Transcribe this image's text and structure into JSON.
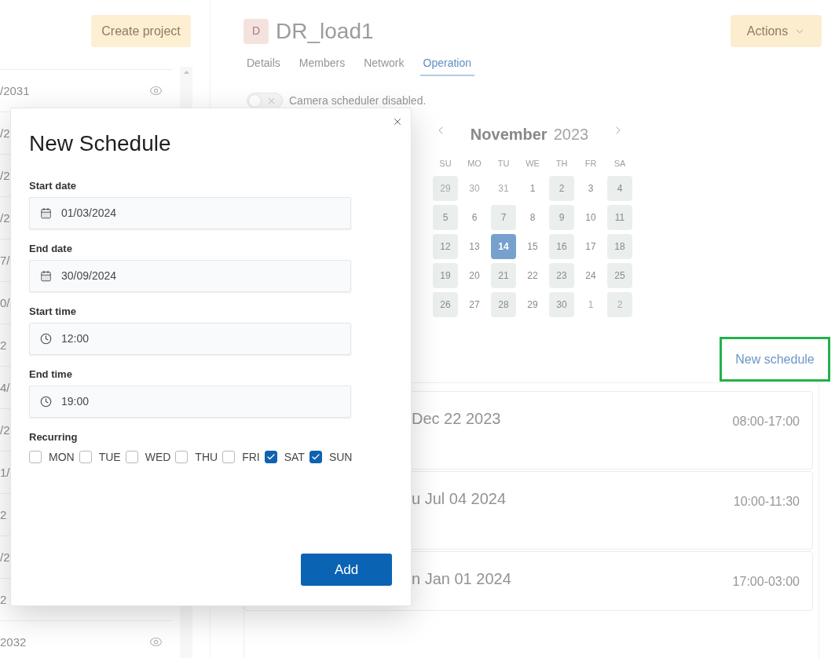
{
  "sidebar": {
    "create_button": "Create project",
    "rows": [
      {
        "text": "/2031",
        "eye_icon": true
      },
      {
        "text": "/2"
      },
      {
        "text": "/2"
      },
      {
        "text": "/2"
      },
      {
        "text": "7/"
      },
      {
        "text": "0/"
      },
      {
        "text": "2"
      },
      {
        "text": "4/"
      },
      {
        "text": "/2"
      },
      {
        "text": "1/"
      },
      {
        "text": "2"
      },
      {
        "text": "/2"
      },
      {
        "text": "2"
      },
      {
        "text": "2032",
        "eye_icon": true
      }
    ]
  },
  "project": {
    "avatar": "D",
    "title": "DR_load1",
    "actions_button": "Actions"
  },
  "tabs": [
    {
      "label": "Details",
      "selected": false
    },
    {
      "label": "Members",
      "selected": false
    },
    {
      "label": "Network",
      "selected": false
    },
    {
      "label": "Operation",
      "selected": true
    }
  ],
  "scheduler": {
    "on": false,
    "label": "Camera scheduler disabled."
  },
  "calendar": {
    "month": "November",
    "year": "2023",
    "weekdays": [
      "SU",
      "MO",
      "TU",
      "WE",
      "TH",
      "FR",
      "SA"
    ],
    "days": [
      {
        "label": "29",
        "marked": true,
        "selected": false,
        "outside": true
      },
      {
        "label": "30",
        "marked": false,
        "selected": false,
        "outside": true
      },
      {
        "label": "31",
        "marked": false,
        "selected": false,
        "outside": true
      },
      {
        "label": "1",
        "marked": false,
        "selected": false,
        "outside": false
      },
      {
        "label": "2",
        "marked": true,
        "selected": false,
        "outside": false
      },
      {
        "label": "3",
        "marked": false,
        "selected": false,
        "outside": false
      },
      {
        "label": "4",
        "marked": true,
        "selected": false,
        "outside": false
      },
      {
        "label": "5",
        "marked": true,
        "selected": false,
        "outside": false
      },
      {
        "label": "6",
        "marked": false,
        "selected": false,
        "outside": false
      },
      {
        "label": "7",
        "marked": true,
        "selected": false,
        "outside": false
      },
      {
        "label": "8",
        "marked": false,
        "selected": false,
        "outside": false
      },
      {
        "label": "9",
        "marked": true,
        "selected": false,
        "outside": false
      },
      {
        "label": "10",
        "marked": false,
        "selected": false,
        "outside": false
      },
      {
        "label": "11",
        "marked": true,
        "selected": false,
        "outside": false
      },
      {
        "label": "12",
        "marked": true,
        "selected": false,
        "outside": false
      },
      {
        "label": "13",
        "marked": false,
        "selected": false,
        "outside": false
      },
      {
        "label": "14",
        "marked": false,
        "selected": true,
        "outside": false
      },
      {
        "label": "15",
        "marked": false,
        "selected": false,
        "outside": false
      },
      {
        "label": "16",
        "marked": true,
        "selected": false,
        "outside": false
      },
      {
        "label": "17",
        "marked": false,
        "selected": false,
        "outside": false
      },
      {
        "label": "18",
        "marked": true,
        "selected": false,
        "outside": false
      },
      {
        "label": "19",
        "marked": true,
        "selected": false,
        "outside": false
      },
      {
        "label": "20",
        "marked": false,
        "selected": false,
        "outside": false
      },
      {
        "label": "21",
        "marked": true,
        "selected": false,
        "outside": false
      },
      {
        "label": "22",
        "marked": false,
        "selected": false,
        "outside": false
      },
      {
        "label": "23",
        "marked": true,
        "selected": false,
        "outside": false
      },
      {
        "label": "24",
        "marked": false,
        "selected": false,
        "outside": false
      },
      {
        "label": "25",
        "marked": true,
        "selected": false,
        "outside": false
      },
      {
        "label": "26",
        "marked": true,
        "selected": false,
        "outside": false
      },
      {
        "label": "27",
        "marked": false,
        "selected": false,
        "outside": false
      },
      {
        "label": "28",
        "marked": true,
        "selected": false,
        "outside": false
      },
      {
        "label": "29",
        "marked": false,
        "selected": false,
        "outside": false
      },
      {
        "label": "30",
        "marked": true,
        "selected": false,
        "outside": false
      },
      {
        "label": "1",
        "marked": false,
        "selected": false,
        "outside": true
      },
      {
        "label": "2",
        "marked": true,
        "selected": false,
        "outside": true
      }
    ]
  },
  "new_schedule": {
    "label": "New schedule",
    "highlighted": true
  },
  "schedules": [
    {
      "date": "Dec 22 2023",
      "time": "08:00-17:00"
    },
    {
      "date": "u Jul 04 2024",
      "time": "10:00-11:30"
    },
    {
      "date": "n Jan 01 2024",
      "time": "17:00-03:00"
    }
  ],
  "dialog": {
    "title": "New Schedule",
    "fields": [
      {
        "label": "Start date",
        "kind": "date",
        "value": "01/03/2024"
      },
      {
        "label": "End date",
        "kind": "date",
        "value": "30/09/2024"
      },
      {
        "label": "Start time",
        "kind": "time",
        "value": "12:00"
      },
      {
        "label": "End time",
        "kind": "time",
        "value": "19:00"
      }
    ],
    "recurring": {
      "label": "Recurring",
      "days": [
        {
          "label": "MON",
          "checked": false
        },
        {
          "label": "TUE",
          "checked": false
        },
        {
          "label": "WED",
          "checked": false
        },
        {
          "label": "THU",
          "checked": false
        },
        {
          "label": "FRI",
          "checked": false
        },
        {
          "label": "SAT",
          "checked": true
        },
        {
          "label": "SUN",
          "checked": true
        }
      ]
    },
    "submit_button": "Add"
  }
}
